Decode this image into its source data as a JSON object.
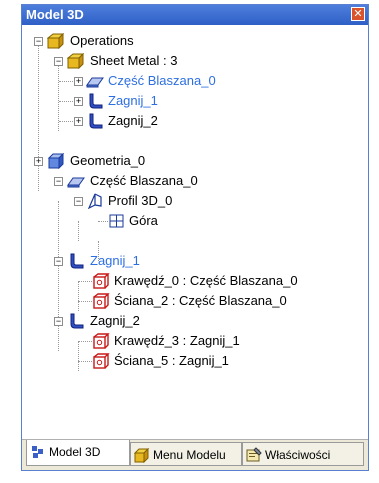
{
  "window": {
    "title": "Model 3D",
    "close_symbol": "✕"
  },
  "tree": {
    "nodes": [
      {
        "label": "Operations",
        "icon": "operations-folder-icon",
        "expander": "−"
      },
      {
        "label": "Sheet Metal : 3",
        "icon": "sheet-metal-icon",
        "expander": "−"
      },
      {
        "label": "Część Blaszana_0",
        "icon": "sheet-part-icon",
        "expander": "+",
        "highlight": true
      },
      {
        "label": "Zagnij_1",
        "icon": "bend-icon",
        "expander": "+",
        "highlight": true
      },
      {
        "label": "Zagnij_2",
        "icon": "bend-icon",
        "expander": "+"
      },
      {
        "label": "Geometria_0",
        "icon": "geometry-cube-icon",
        "expander": "+"
      },
      {
        "label": "Część Blaszana_0",
        "icon": "sheet-part-icon",
        "expander": "−"
      },
      {
        "label": "Profil 3D_0",
        "icon": "profile-3d-icon",
        "expander": "−"
      },
      {
        "label": "Góra",
        "icon": "plane-grid-icon",
        "expander": ""
      },
      {
        "label": "Zagnij_1",
        "icon": "bend-icon",
        "expander": "−",
        "highlight": true
      },
      {
        "label": "Krawędź_0 : Część Blaszana_0",
        "icon": "edge-face-icon",
        "expander": ""
      },
      {
        "label": "Ściana_2 : Część Blaszana_0",
        "icon": "edge-face-icon",
        "expander": ""
      },
      {
        "label": "Zagnij_2",
        "icon": "bend-icon",
        "expander": "−"
      },
      {
        "label": "Krawędź_3 : Zagnij_1",
        "icon": "edge-face-icon",
        "expander": ""
      },
      {
        "label": "Ściana_5 : Zagnij_1",
        "icon": "edge-face-icon",
        "expander": ""
      }
    ]
  },
  "tabs": [
    {
      "label": "Model 3D",
      "icon": "model-3d-tab-icon",
      "active": true
    },
    {
      "label": "Menu Modelu",
      "icon": "model-menu-tab-icon",
      "active": false
    },
    {
      "label": "Właściwości",
      "icon": "properties-tab-icon",
      "active": false
    }
  ],
  "colors": {
    "title_bar": "#2e5fc6",
    "highlight_text": "#2d6fe0",
    "tab_bar": "#ece9d8"
  }
}
